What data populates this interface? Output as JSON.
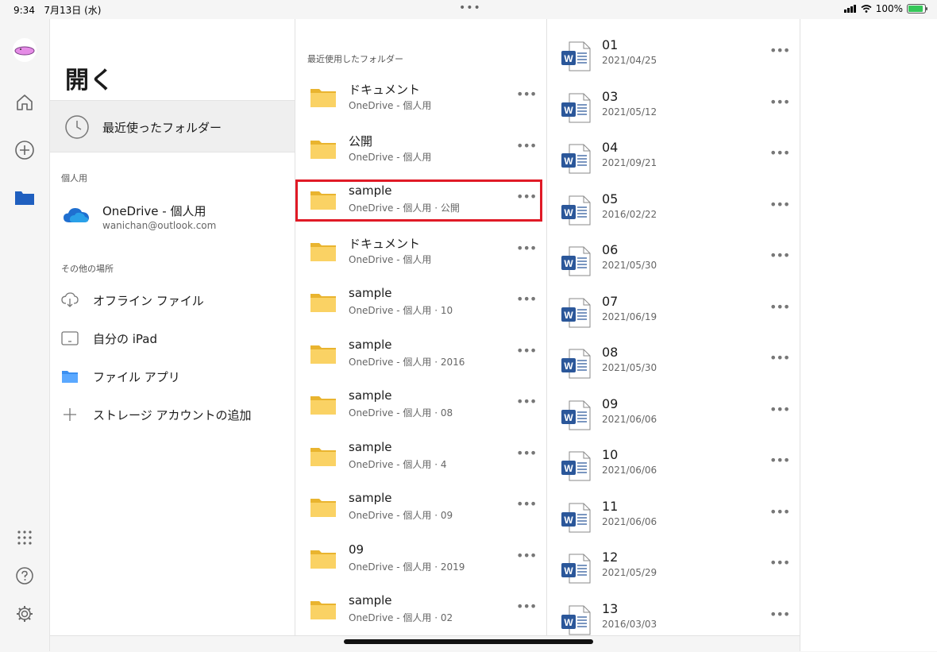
{
  "status": {
    "time": "9:34",
    "date": "7月13日 (水)",
    "battery": "100%",
    "dots": "•••"
  },
  "rail": {
    "icons": [
      "avatar",
      "home-icon",
      "add-icon",
      "folder-icon",
      "apps-grid-icon",
      "help-icon",
      "settings-icon"
    ]
  },
  "nav": {
    "title": "開く",
    "recent_label": "最近使ったフォルダー",
    "personal_header": "個人用",
    "onedrive_label": "OneDrive - 個人用",
    "onedrive_account": "wanichan@outlook.com",
    "other_header": "その他の場所",
    "places": [
      {
        "label": "オフライン ファイル",
        "icon": "cloud-download-icon"
      },
      {
        "label": "自分の iPad",
        "icon": "ipad-icon"
      },
      {
        "label": "ファイル アプリ",
        "icon": "files-app-icon"
      },
      {
        "label": "ストレージ アカウントの追加",
        "icon": "plus-icon"
      }
    ]
  },
  "folders": {
    "header": "最近使用したフォルダー",
    "items": [
      {
        "name": "ドキュメント",
        "sub": "OneDrive - 個人用"
      },
      {
        "name": "公開",
        "sub": "OneDrive - 個人用"
      },
      {
        "name": "sample",
        "sub": "OneDrive - 個人用 · 公開"
      },
      {
        "name": "ドキュメント",
        "sub": "OneDrive - 個人用"
      },
      {
        "name": "sample",
        "sub": "OneDrive - 個人用 · 10"
      },
      {
        "name": "sample",
        "sub": "OneDrive - 個人用 · 2016"
      },
      {
        "name": "sample",
        "sub": "OneDrive - 個人用 · 08"
      },
      {
        "name": "sample",
        "sub": "OneDrive - 個人用 · 4"
      },
      {
        "name": "sample",
        "sub": "OneDrive - 個人用 · 09"
      },
      {
        "name": "09",
        "sub": "OneDrive - 個人用 · 2019"
      },
      {
        "name": "sample",
        "sub": "OneDrive - 個人用 · 02"
      }
    ],
    "more": "•••"
  },
  "documents": {
    "items": [
      {
        "name": "01",
        "date": "2021/04/25"
      },
      {
        "name": "03",
        "date": "2021/05/12"
      },
      {
        "name": "04",
        "date": "2021/09/21"
      },
      {
        "name": "05",
        "date": "2016/02/22"
      },
      {
        "name": "06",
        "date": "2021/05/30"
      },
      {
        "name": "07",
        "date": "2021/06/19"
      },
      {
        "name": "08",
        "date": "2021/05/30"
      },
      {
        "name": "09",
        "date": "2021/06/06"
      },
      {
        "name": "10",
        "date": "2021/06/06"
      },
      {
        "name": "11",
        "date": "2021/06/06"
      },
      {
        "name": "12",
        "date": "2021/05/29"
      },
      {
        "name": "13",
        "date": "2016/03/03"
      }
    ],
    "word_letter": "W",
    "more": "•••"
  },
  "colors": {
    "highlight": "#e01a26",
    "folder": "#f5c542",
    "word": "#2b579a",
    "accent": "#1f5fbf"
  }
}
